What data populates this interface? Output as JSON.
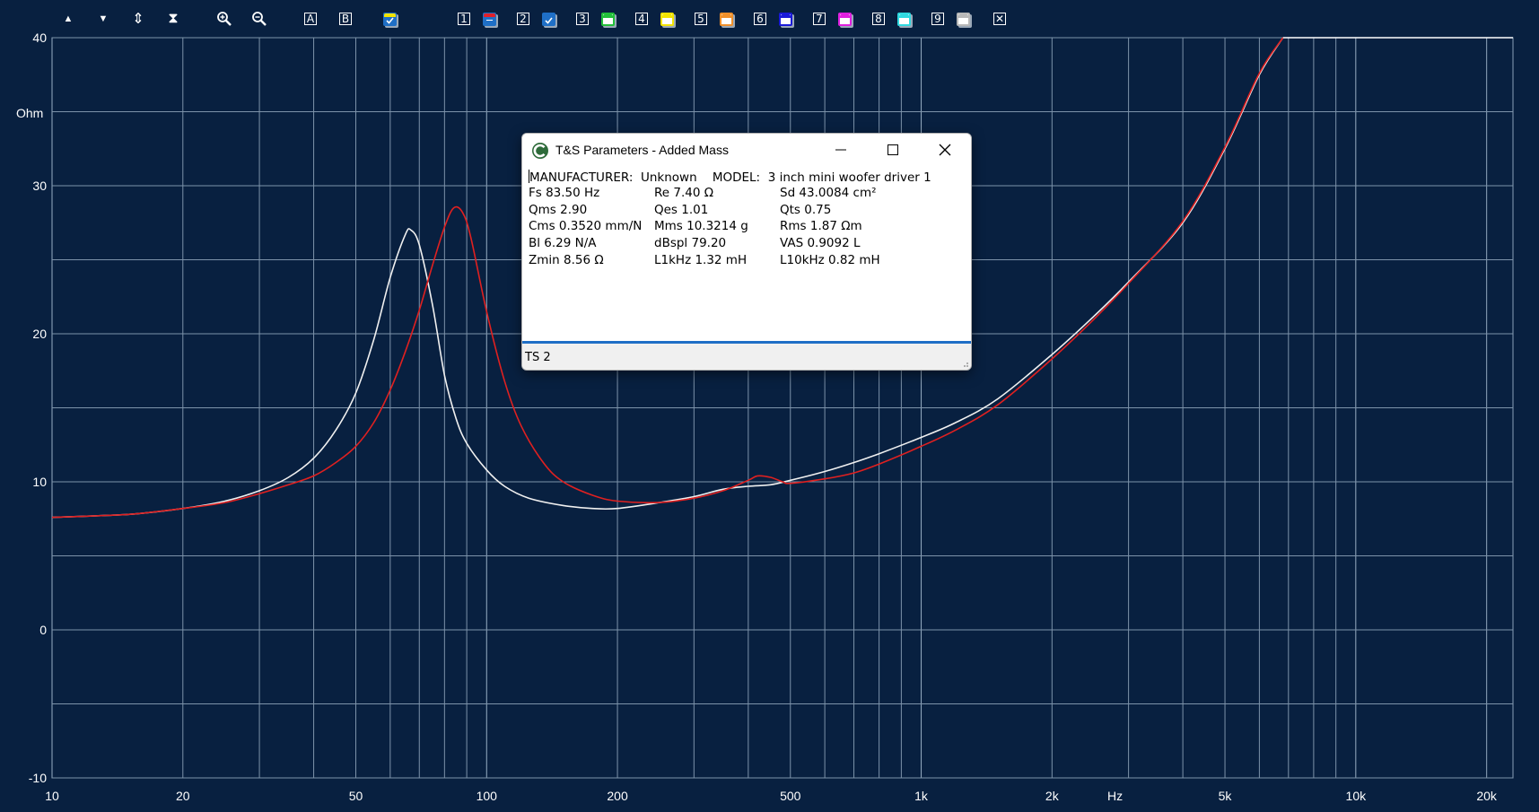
{
  "toolbar": {
    "nav_buttons": [
      {
        "name": "move-up-button",
        "glyph": "▲"
      },
      {
        "name": "move-down-button",
        "glyph": "▼"
      },
      {
        "name": "expand-vertical-button",
        "glyph": "⇕"
      },
      {
        "name": "compress-vertical-button",
        "glyph": "⧗"
      }
    ],
    "zoom_in_icon": "zoom-in-icon",
    "zoom_out_icon": "zoom-out-icon",
    "cursor_a": "A",
    "cursor_b": "B",
    "trace_slots": [
      {
        "label": "1",
        "color": "#e0202a"
      },
      {
        "label": "2",
        "color": "#1f6fc6"
      },
      {
        "label": "3",
        "color": "#22c03a"
      },
      {
        "label": "4",
        "color": "#f2e400"
      },
      {
        "label": "5",
        "color": "#f0902a"
      },
      {
        "label": "6",
        "color": "#1a1ad8"
      },
      {
        "label": "7",
        "color": "#e020e0"
      },
      {
        "label": "8",
        "color": "#30d8e0"
      },
      {
        "label": "9",
        "color": "#b8b8b8"
      }
    ],
    "close_all": "✕"
  },
  "chart_data": {
    "type": "line",
    "xscale": "log",
    "xlim": [
      10,
      23000
    ],
    "ylim": [
      -10,
      40
    ],
    "ylabel": "Ohm",
    "xlabel": "Hz",
    "x_ticks": [
      {
        "v": 10,
        "label": "10"
      },
      {
        "v": 20,
        "label": "20"
      },
      {
        "v": 50,
        "label": "50"
      },
      {
        "v": 100,
        "label": "100"
      },
      {
        "v": 200,
        "label": "200"
      },
      {
        "v": 500,
        "label": "500"
      },
      {
        "v": 1000,
        "label": "1k"
      },
      {
        "v": 2000,
        "label": "2k"
      },
      {
        "v": 5000,
        "label": "5k"
      },
      {
        "v": 10000,
        "label": "10k"
      },
      {
        "v": 20000,
        "label": "20k"
      }
    ],
    "y_ticks": [
      {
        "v": 40,
        "label": "40"
      },
      {
        "v": 30,
        "label": "30"
      },
      {
        "v": 20,
        "label": "20"
      },
      {
        "v": 10,
        "label": "10"
      },
      {
        "v": 0,
        "label": "0"
      },
      {
        "v": -10,
        "label": "-10"
      }
    ],
    "grid": true,
    "series": [
      {
        "color": "#f0f0f0",
        "points": [
          [
            10,
            7.6
          ],
          [
            15,
            7.8
          ],
          [
            20,
            8.2
          ],
          [
            25,
            8.7
          ],
          [
            30,
            9.4
          ],
          [
            35,
            10.3
          ],
          [
            40,
            11.6
          ],
          [
            45,
            13.5
          ],
          [
            50,
            16.0
          ],
          [
            55,
            19.6
          ],
          [
            60,
            23.8
          ],
          [
            65,
            26.7
          ],
          [
            67,
            27.0
          ],
          [
            70,
            26.0
          ],
          [
            75,
            22.0
          ],
          [
            80,
            17.2
          ],
          [
            85,
            14.3
          ],
          [
            90,
            12.6
          ],
          [
            100,
            10.8
          ],
          [
            110,
            9.7
          ],
          [
            125,
            8.9
          ],
          [
            150,
            8.4
          ],
          [
            175,
            8.2
          ],
          [
            200,
            8.2
          ],
          [
            250,
            8.6
          ],
          [
            300,
            9.0
          ],
          [
            350,
            9.5
          ],
          [
            400,
            9.7
          ],
          [
            450,
            9.8
          ],
          [
            500,
            10.1
          ],
          [
            600,
            10.7
          ],
          [
            700,
            11.3
          ],
          [
            800,
            11.9
          ],
          [
            1000,
            13.0
          ],
          [
            1200,
            14.0
          ],
          [
            1500,
            15.6
          ],
          [
            2000,
            18.6
          ],
          [
            2500,
            21.2
          ],
          [
            3000,
            23.5
          ],
          [
            4000,
            27.5
          ],
          [
            5000,
            32.5
          ],
          [
            6000,
            37.5
          ],
          [
            6800,
            40.0
          ]
        ]
      },
      {
        "color": "#e02020",
        "points": [
          [
            10,
            7.6
          ],
          [
            15,
            7.8
          ],
          [
            20,
            8.2
          ],
          [
            25,
            8.6
          ],
          [
            30,
            9.2
          ],
          [
            35,
            9.8
          ],
          [
            40,
            10.4
          ],
          [
            45,
            11.3
          ],
          [
            50,
            12.4
          ],
          [
            55,
            14.0
          ],
          [
            60,
            16.2
          ],
          [
            65,
            18.8
          ],
          [
            70,
            21.6
          ],
          [
            75,
            24.6
          ],
          [
            80,
            27.2
          ],
          [
            84,
            28.5
          ],
          [
            88,
            28.2
          ],
          [
            92,
            26.5
          ],
          [
            100,
            21.5
          ],
          [
            110,
            16.8
          ],
          [
            120,
            13.8
          ],
          [
            135,
            11.3
          ],
          [
            150,
            10.0
          ],
          [
            175,
            9.1
          ],
          [
            200,
            8.7
          ],
          [
            250,
            8.6
          ],
          [
            300,
            8.9
          ],
          [
            350,
            9.4
          ],
          [
            400,
            10.1
          ],
          [
            420,
            10.4
          ],
          [
            450,
            10.3
          ],
          [
            480,
            10.0
          ],
          [
            500,
            9.9
          ],
          [
            600,
            10.2
          ],
          [
            700,
            10.6
          ],
          [
            800,
            11.2
          ],
          [
            1000,
            12.4
          ],
          [
            1200,
            13.5
          ],
          [
            1500,
            15.2
          ],
          [
            2000,
            18.3
          ],
          [
            2500,
            21.0
          ],
          [
            3000,
            23.4
          ],
          [
            4000,
            27.6
          ],
          [
            5000,
            32.6
          ],
          [
            6000,
            37.6
          ],
          [
            6800,
            40.0
          ]
        ]
      }
    ]
  },
  "dialog": {
    "title": "T&S Parameters - Added Mass",
    "manufacturer_label": "MANUFACTURER:",
    "manufacturer_value": "Unknown",
    "model_label": "MODEL:",
    "model_value": "3 inch mini woofer driver 1",
    "params": [
      [
        "Fs  83.50 Hz",
        "Re  7.40 Ω",
        "Sd  43.0084 cm²"
      ],
      [
        "Qms 2.90",
        "Qes 1.01",
        "Qts 0.75"
      ],
      [
        "Cms 0.3520 mm/N",
        "Mms 10.3214 g",
        "Rms 1.87 Ωm"
      ],
      [
        "Bl   6.29 N/A",
        "dBspl 79.20",
        "VAS  0.9092 L"
      ],
      [
        "Zmin   8.56 Ω",
        "L1kHz  1.32 mH",
        "L10kHz 0.82 mH"
      ]
    ],
    "status": "TS 2"
  }
}
